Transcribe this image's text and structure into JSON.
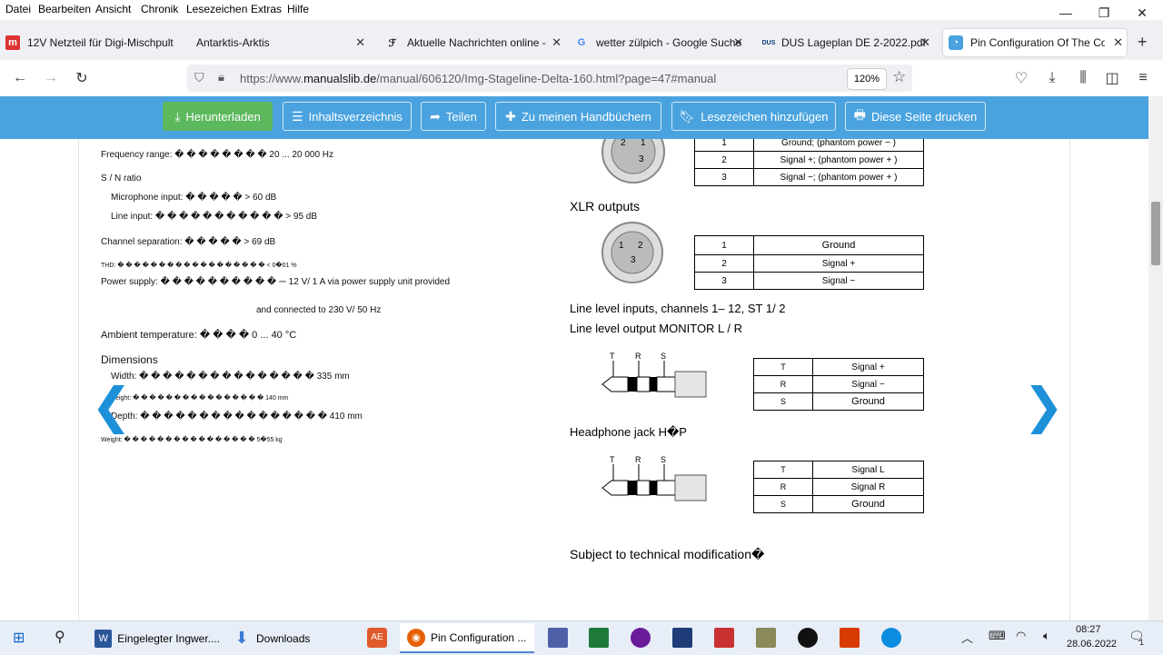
{
  "menubar": {
    "items": [
      "Datei",
      "Bearbeiten",
      "Ansicht",
      "Chronik",
      "Lesezeichen",
      "Extras",
      "Hilfe"
    ],
    "controls": {
      "minimize": "—",
      "restore": "❐",
      "close": "✕"
    }
  },
  "tabs": [
    {
      "label": "12V Netzteil für Digi-Mischpult",
      "icon": "shop-icon",
      "icon_text": "m",
      "close": "✕",
      "active": false
    },
    {
      "label": "Antarktis-Arktis",
      "icon": "",
      "icon_text": "",
      "close": "✕",
      "active": false
    },
    {
      "label": "Aktuelle Nachrichten online - F",
      "icon": "news-icon",
      "icon_text": "ℱ",
      "close": "✕",
      "active": false
    },
    {
      "label": "wetter zülpich - Google Suche",
      "icon": "google-icon",
      "icon_text": "G",
      "close": "✕",
      "active": false
    },
    {
      "label": "DUS Lageplan DE 2-2022.pdf",
      "icon": "dus-icon",
      "icon_text": "DUS",
      "close": "✕",
      "active": false
    },
    {
      "label": "Pin Configuration Of The Conn",
      "icon": "manualslib-icon",
      "icon_text": "◔",
      "close": "✕",
      "active": true
    }
  ],
  "new_tab": "+",
  "nav": {
    "url_scheme": "https://www.",
    "url_host": "manualslib.de",
    "url_path": "/manual/606120/Img-Stageline-Delta-160.html?page=47#manual",
    "zoom": "120%"
  },
  "toolbar": {
    "download": "Herunterladen",
    "toc": "Inhaltsverzeichnis",
    "share": "Teilen",
    "add": "Zu meinen Handbüchern",
    "bookmark": "Lesezeichen hinzufügen",
    "print": "Diese Seite drucken"
  },
  "specs": {
    "freq": "Frequency range: � � � � � � � � 20 ... 20 000 Hz",
    "sn": "S / N ratio",
    "mic": "Microphone input: � � � � � > 60 dB",
    "line": "Line input: � � � � � � � � � � � > 95 dB",
    "chsep": "Channel separation: � � � � � > 69 dB",
    "thd": "THD: � � � � � � � � � � � � � � � � � � < 0�01 %",
    "power": "Power supply: � � � � � � � � � � ⎓ 12 V/ 1 A via power supply unit provided",
    "power2": "and connected to 230 V/ 50 Hz",
    "ambient": "Ambient temperature: � � � � 0 ... 40 °C",
    "dimensions": "Dimensions",
    "width": "Width: � � � � � � � � � � � � � � � 335 mm",
    "height": "Height: � � � � � � � � � � � � � � � � 140 mm",
    "depth": "Depth: � � � � � � � � � � � � � � � � 410 mm",
    "weight": "Weight: � � � � � � � � � � � � � � � � 5�55 kg"
  },
  "pins": {
    "xlr_in": [
      [
        "1",
        "Ground; (phantom power − )"
      ],
      [
        "2",
        "Signal +; (phantom power + )"
      ],
      [
        "3",
        "Signal −; (phantom power + )"
      ]
    ],
    "xlr_out_title": "XLR outputs",
    "xlr_out": [
      [
        "1",
        "Ground"
      ],
      [
        "2",
        "Signal +"
      ],
      [
        "3",
        "Signal −"
      ]
    ],
    "line_inputs": "Line level inputs, channels 1– 12, ST 1/ 2",
    "line_output": "Line level output MONITOR L / R",
    "trs_labels": [
      "T",
      "R",
      "S"
    ],
    "line_table": [
      [
        "T",
        "Signal +"
      ],
      [
        "R",
        "Signal −"
      ],
      [
        "S",
        "Ground"
      ]
    ],
    "headphone_title": "Headphone jack H�P",
    "hp_table": [
      [
        "T",
        "Signal L"
      ],
      [
        "R",
        "Signal R"
      ],
      [
        "S",
        "Ground"
      ]
    ],
    "xlr_in_pins": [
      "2",
      "1",
      "3"
    ],
    "xlr_out_pins": [
      "1",
      "2",
      "3"
    ],
    "subject": "Subject to technical modification�"
  },
  "nav_arrows": {
    "prev": "❮",
    "next": "❯"
  },
  "taskbar": {
    "items": [
      {
        "label": "Eingelegter Ingwer....",
        "icon": "word-icon",
        "color": "#2b579a"
      },
      {
        "label": "Downloads",
        "icon": "download-arrow-icon",
        "color": "#3a7bd5"
      },
      {
        "label": "Pin Configuration ...",
        "icon": "firefox-icon",
        "color": "#e66000"
      }
    ],
    "time": "08:27",
    "date": "28.06.2022",
    "notification_count": "1"
  }
}
